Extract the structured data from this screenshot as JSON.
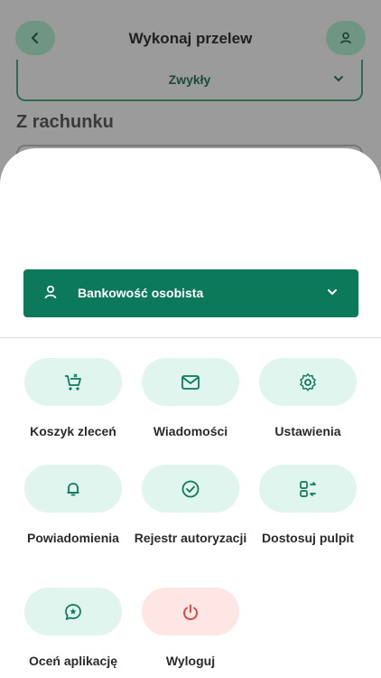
{
  "header": {
    "title": "Wykonaj przelew"
  },
  "transfer_type": {
    "selected": "Zwykły"
  },
  "section": {
    "from_account": "Z rachunku"
  },
  "profile": {
    "label": "Bankowość osobista"
  },
  "menu": [
    {
      "label": "Koszyk zleceń",
      "icon": "cart-icon"
    },
    {
      "label": "Wiadomości",
      "icon": "envelope-icon"
    },
    {
      "label": "Ustawienia",
      "icon": "gear-icon"
    },
    {
      "label": "Powiadomienia",
      "icon": "bell-icon"
    },
    {
      "label": "Rejestr autoryzacji",
      "icon": "check-circle-icon"
    },
    {
      "label": "Dostosuj pulpit",
      "icon": "customize-icon"
    },
    {
      "label": "Oceń aplikację",
      "icon": "rate-chat-icon"
    },
    {
      "label": "Wyloguj",
      "icon": "power-icon"
    }
  ],
  "colors": {
    "primary": "#0c7a5a",
    "pill": "#dff5ee",
    "logout_pill": "#fde6e4",
    "logout_icon": "#e0413a"
  }
}
